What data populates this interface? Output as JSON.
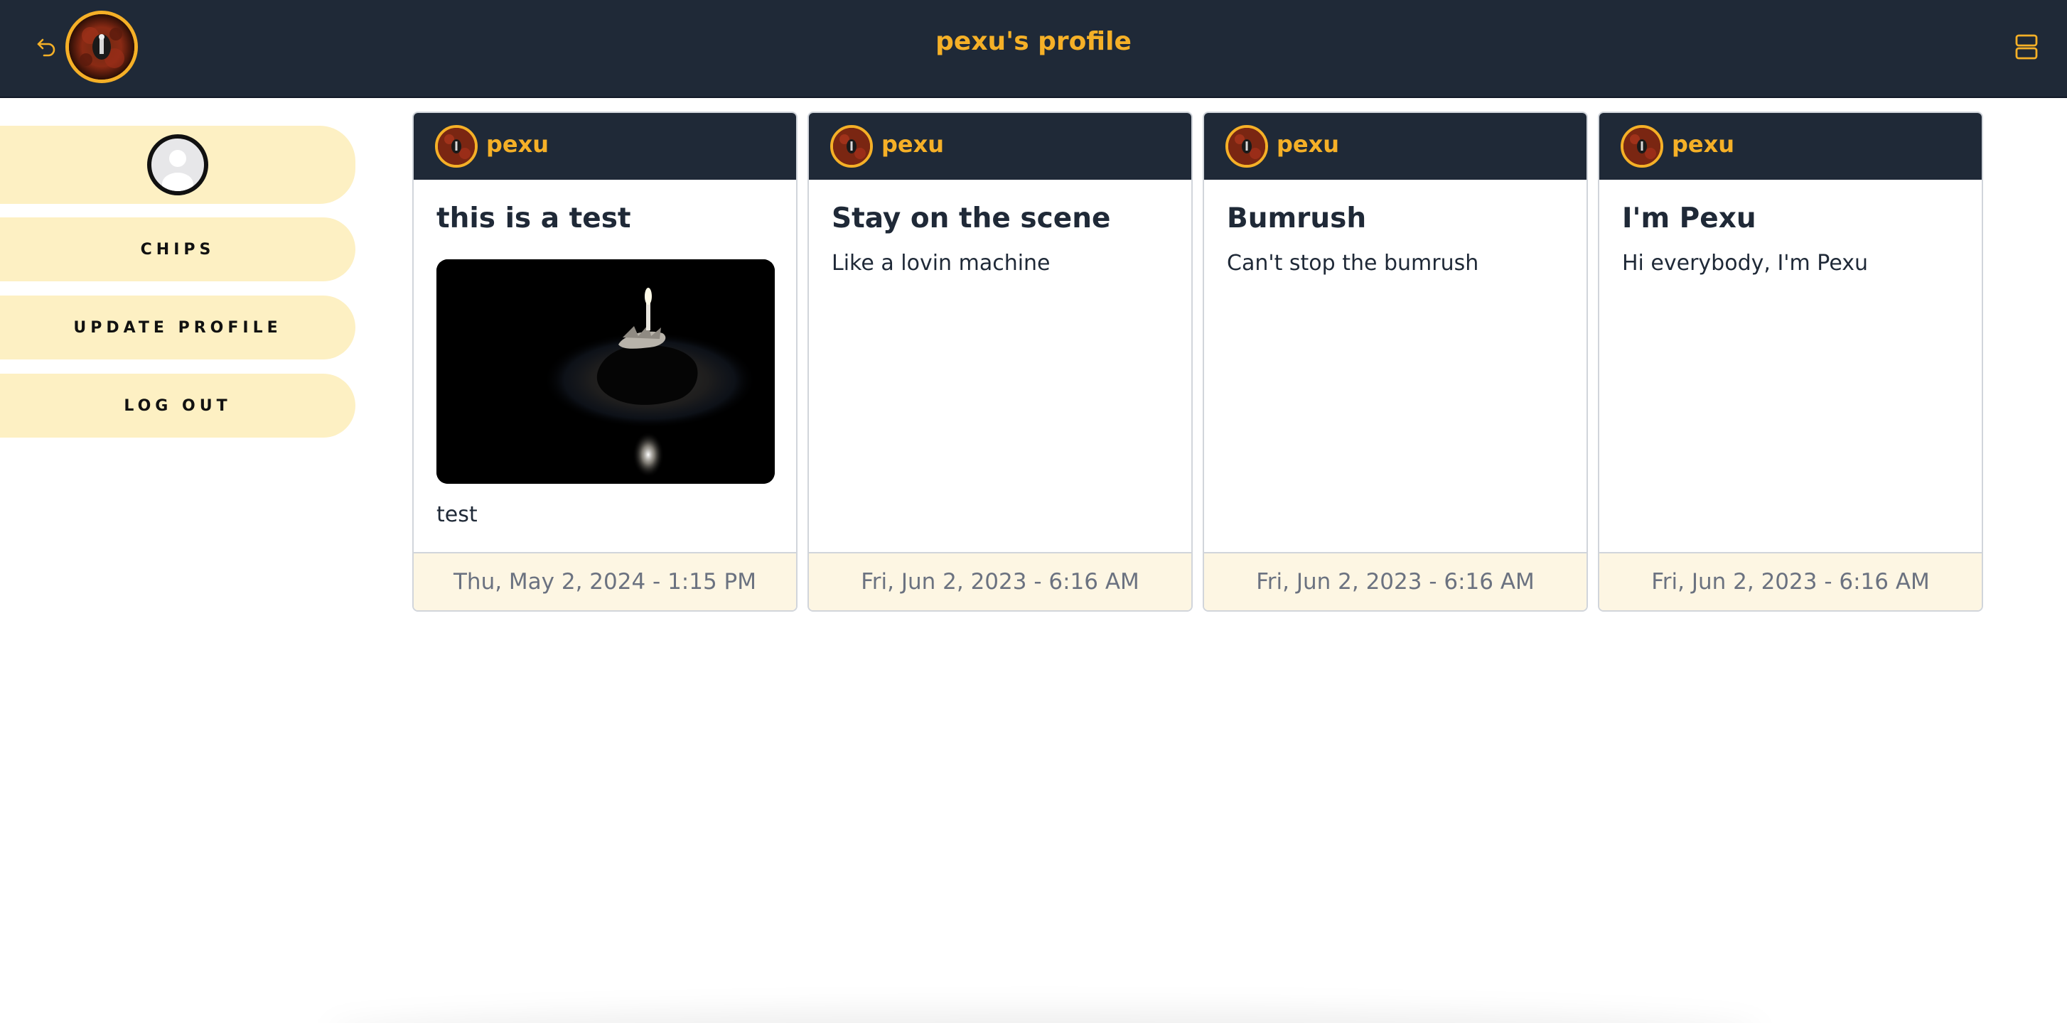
{
  "header": {
    "title": "pexu's profile",
    "back_icon": "undo-arrow-icon",
    "menu_icon": "layout-rows-icon"
  },
  "sidebar": {
    "items": [
      {
        "type": "avatar",
        "icon": "user-avatar-icon"
      },
      {
        "label": "CHIPS"
      },
      {
        "label": "UPDATE PROFILE"
      },
      {
        "label": "LOG OUT"
      }
    ]
  },
  "posts": [
    {
      "author": "pexu",
      "title": "this is a test",
      "has_image": true,
      "body": "test",
      "timestamp": "Thu, May 2, 2024 - 1:15 PM"
    },
    {
      "author": "pexu",
      "title": "Stay on the scene",
      "has_image": false,
      "body": "Like a lovin machine",
      "timestamp": "Fri, Jun 2, 2023 - 6:16 AM"
    },
    {
      "author": "pexu",
      "title": "Bumrush",
      "has_image": false,
      "body": "Can't stop the bumrush",
      "timestamp": "Fri, Jun 2, 2023 - 6:16 AM"
    },
    {
      "author": "pexu",
      "title": "I'm Pexu",
      "has_image": false,
      "body": "Hi everybody, I'm Pexu",
      "timestamp": "Fri, Jun 2, 2023 - 6:16 AM"
    }
  ],
  "colors": {
    "header_bg": "#1f2937",
    "accent": "#f5b027",
    "sidebar_pill": "#fdf0c3",
    "card_footer_bg": "#fdf6e3"
  }
}
